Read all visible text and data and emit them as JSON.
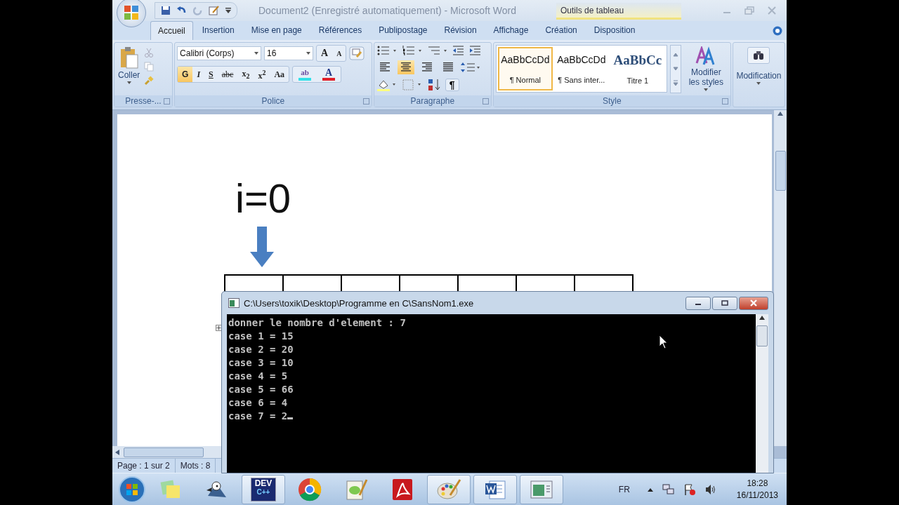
{
  "window": {
    "title": "Document2 (Enregistré automatiquement) - Microsoft Word",
    "context_group": "Outils de tableau"
  },
  "tabs": [
    {
      "label": "Accueil",
      "selected": true
    },
    {
      "label": "Insertion",
      "selected": false
    },
    {
      "label": "Mise en page",
      "selected": false
    },
    {
      "label": "Références",
      "selected": false
    },
    {
      "label": "Publipostage",
      "selected": false
    },
    {
      "label": "Révision",
      "selected": false
    },
    {
      "label": "Affichage",
      "selected": false
    },
    {
      "label": "Création",
      "selected": false
    },
    {
      "label": "Disposition",
      "selected": false
    }
  ],
  "clipboard": {
    "paste": "Coller",
    "label": "Presse-..."
  },
  "font": {
    "family": "Calibri (Corps)",
    "size": "16",
    "label": "Police",
    "grow": "A",
    "shrink": "A",
    "buttons": [
      {
        "label": "G",
        "selected": true
      },
      {
        "label": "I",
        "selected": false
      },
      {
        "label": "S",
        "selected": false
      },
      {
        "label": "abc",
        "selected": false
      },
      {
        "label": "x$_{2}$",
        "selected": false
      },
      {
        "label": "x$^{2}$",
        "selected": false
      },
      {
        "label": "Aa",
        "selected": false
      }
    ],
    "swatches": [
      {
        "label": "ab",
        "color": "#33e0e8"
      },
      {
        "label": "A",
        "color": "#e0202a"
      }
    ]
  },
  "paragraph": {
    "label": "Paragraphe",
    "pilcrow": "¶",
    "align": [
      {
        "selected": false
      },
      {
        "selected": true
      },
      {
        "selected": false
      },
      {
        "selected": false
      }
    ]
  },
  "styles": {
    "label": "Style",
    "modify": "Modifier les styles",
    "items": [
      {
        "preview": "AaBbCcDd",
        "name": "¶ Normal",
        "selected": true,
        "kind": "body"
      },
      {
        "preview": "AaBbCcDd",
        "name": "¶ Sans inter...",
        "selected": false,
        "kind": "body"
      },
      {
        "preview": "AaBbCc",
        "name": "Titre 1",
        "selected": false,
        "kind": "heading"
      }
    ]
  },
  "editing": {
    "label": "Modification"
  },
  "document": {
    "heading": "i=0"
  },
  "status_bar": {
    "page": "Page : 1 sur 2",
    "words": "Mots : 8"
  },
  "console": {
    "title": "C:\\Users\\toxik\\Desktop\\Programme en C\\SansNom1.exe",
    "cursor": true,
    "lines": [
      "donner le nombre d'element : 7",
      "case 1 = 15",
      "case 2 = 20",
      "case 3 = 10",
      "case 4 = 5",
      "case 5 = 66",
      "case 6 = 4",
      "case 7 = 2"
    ]
  },
  "taskbar": {
    "dev_label": "DEV",
    "dev_sub": "C++",
    "language": "FR",
    "time": "18:28",
    "date": "16/11/2013"
  }
}
